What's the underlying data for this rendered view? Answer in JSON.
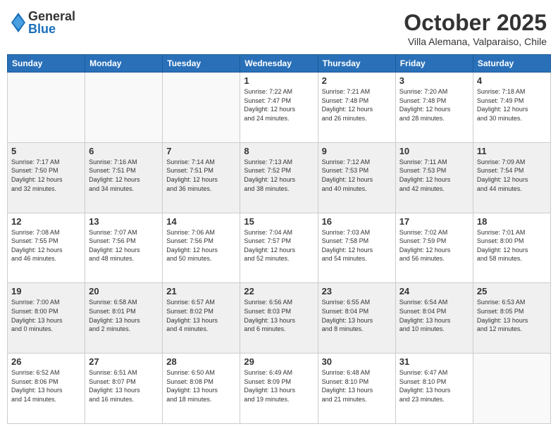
{
  "header": {
    "logo_general": "General",
    "logo_blue": "Blue",
    "month": "October 2025",
    "location": "Villa Alemana, Valparaiso, Chile"
  },
  "calendar": {
    "days_of_week": [
      "Sunday",
      "Monday",
      "Tuesday",
      "Wednesday",
      "Thursday",
      "Friday",
      "Saturday"
    ],
    "weeks": [
      [
        {
          "day": "",
          "info": ""
        },
        {
          "day": "",
          "info": ""
        },
        {
          "day": "",
          "info": ""
        },
        {
          "day": "1",
          "info": "Sunrise: 7:22 AM\nSunset: 7:47 PM\nDaylight: 12 hours\nand 24 minutes."
        },
        {
          "day": "2",
          "info": "Sunrise: 7:21 AM\nSunset: 7:48 PM\nDaylight: 12 hours\nand 26 minutes."
        },
        {
          "day": "3",
          "info": "Sunrise: 7:20 AM\nSunset: 7:48 PM\nDaylight: 12 hours\nand 28 minutes."
        },
        {
          "day": "4",
          "info": "Sunrise: 7:18 AM\nSunset: 7:49 PM\nDaylight: 12 hours\nand 30 minutes."
        }
      ],
      [
        {
          "day": "5",
          "info": "Sunrise: 7:17 AM\nSunset: 7:50 PM\nDaylight: 12 hours\nand 32 minutes."
        },
        {
          "day": "6",
          "info": "Sunrise: 7:16 AM\nSunset: 7:51 PM\nDaylight: 12 hours\nand 34 minutes."
        },
        {
          "day": "7",
          "info": "Sunrise: 7:14 AM\nSunset: 7:51 PM\nDaylight: 12 hours\nand 36 minutes."
        },
        {
          "day": "8",
          "info": "Sunrise: 7:13 AM\nSunset: 7:52 PM\nDaylight: 12 hours\nand 38 minutes."
        },
        {
          "day": "9",
          "info": "Sunrise: 7:12 AM\nSunset: 7:53 PM\nDaylight: 12 hours\nand 40 minutes."
        },
        {
          "day": "10",
          "info": "Sunrise: 7:11 AM\nSunset: 7:53 PM\nDaylight: 12 hours\nand 42 minutes."
        },
        {
          "day": "11",
          "info": "Sunrise: 7:09 AM\nSunset: 7:54 PM\nDaylight: 12 hours\nand 44 minutes."
        }
      ],
      [
        {
          "day": "12",
          "info": "Sunrise: 7:08 AM\nSunset: 7:55 PM\nDaylight: 12 hours\nand 46 minutes."
        },
        {
          "day": "13",
          "info": "Sunrise: 7:07 AM\nSunset: 7:56 PM\nDaylight: 12 hours\nand 48 minutes."
        },
        {
          "day": "14",
          "info": "Sunrise: 7:06 AM\nSunset: 7:56 PM\nDaylight: 12 hours\nand 50 minutes."
        },
        {
          "day": "15",
          "info": "Sunrise: 7:04 AM\nSunset: 7:57 PM\nDaylight: 12 hours\nand 52 minutes."
        },
        {
          "day": "16",
          "info": "Sunrise: 7:03 AM\nSunset: 7:58 PM\nDaylight: 12 hours\nand 54 minutes."
        },
        {
          "day": "17",
          "info": "Sunrise: 7:02 AM\nSunset: 7:59 PM\nDaylight: 12 hours\nand 56 minutes."
        },
        {
          "day": "18",
          "info": "Sunrise: 7:01 AM\nSunset: 8:00 PM\nDaylight: 12 hours\nand 58 minutes."
        }
      ],
      [
        {
          "day": "19",
          "info": "Sunrise: 7:00 AM\nSunset: 8:00 PM\nDaylight: 13 hours\nand 0 minutes."
        },
        {
          "day": "20",
          "info": "Sunrise: 6:58 AM\nSunset: 8:01 PM\nDaylight: 13 hours\nand 2 minutes."
        },
        {
          "day": "21",
          "info": "Sunrise: 6:57 AM\nSunset: 8:02 PM\nDaylight: 13 hours\nand 4 minutes."
        },
        {
          "day": "22",
          "info": "Sunrise: 6:56 AM\nSunset: 8:03 PM\nDaylight: 13 hours\nand 6 minutes."
        },
        {
          "day": "23",
          "info": "Sunrise: 6:55 AM\nSunset: 8:04 PM\nDaylight: 13 hours\nand 8 minutes."
        },
        {
          "day": "24",
          "info": "Sunrise: 6:54 AM\nSunset: 8:04 PM\nDaylight: 13 hours\nand 10 minutes."
        },
        {
          "day": "25",
          "info": "Sunrise: 6:53 AM\nSunset: 8:05 PM\nDaylight: 13 hours\nand 12 minutes."
        }
      ],
      [
        {
          "day": "26",
          "info": "Sunrise: 6:52 AM\nSunset: 8:06 PM\nDaylight: 13 hours\nand 14 minutes."
        },
        {
          "day": "27",
          "info": "Sunrise: 6:51 AM\nSunset: 8:07 PM\nDaylight: 13 hours\nand 16 minutes."
        },
        {
          "day": "28",
          "info": "Sunrise: 6:50 AM\nSunset: 8:08 PM\nDaylight: 13 hours\nand 18 minutes."
        },
        {
          "day": "29",
          "info": "Sunrise: 6:49 AM\nSunset: 8:09 PM\nDaylight: 13 hours\nand 19 minutes."
        },
        {
          "day": "30",
          "info": "Sunrise: 6:48 AM\nSunset: 8:10 PM\nDaylight: 13 hours\nand 21 minutes."
        },
        {
          "day": "31",
          "info": "Sunrise: 6:47 AM\nSunset: 8:10 PM\nDaylight: 13 hours\nand 23 minutes."
        },
        {
          "day": "",
          "info": ""
        }
      ]
    ]
  }
}
